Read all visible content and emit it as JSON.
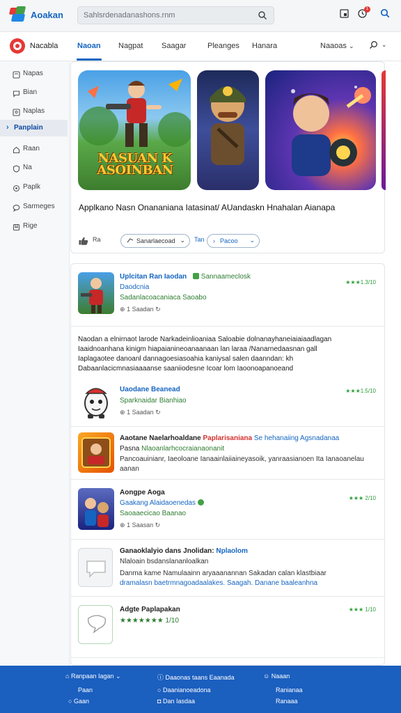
{
  "topbar": {
    "app_title": "Aoakan",
    "search_placeholder": "Sahlsrdenadanashons.rnm",
    "notification_count": "1"
  },
  "nav": {
    "brand": "Nacabla",
    "tabs": [
      "Naoan",
      "Nagpat",
      "Saagar",
      "Pleanges",
      "Hanara"
    ],
    "active_tab": 0,
    "more_label": "Naaoas"
  },
  "sidebar": {
    "items": [
      {
        "label": "Napas",
        "icon": "pages-icon"
      },
      {
        "label": "Bian",
        "icon": "chat-icon"
      },
      {
        "label": "Naplas",
        "icon": "image-icon"
      },
      {
        "label": "Panplain",
        "icon": "chevron-right-icon",
        "active": true
      },
      {
        "label": "Raan",
        "icon": "home-icon"
      },
      {
        "label": "Na",
        "icon": "shield-icon"
      },
      {
        "label": "Paplk",
        "icon": "settings-icon"
      },
      {
        "label": "Sarmeges",
        "icon": "message-icon"
      },
      {
        "label": "Rige",
        "icon": "bookmark-icon"
      }
    ]
  },
  "featured": {
    "art_title": "NASUAN K ASOINBAN",
    "title": "Applkano Nasn Onananiana Iatasinat/ AUandaskn Hnahalan Aianapa",
    "like_count": "Ra",
    "filter_pill": "Sanarlaecoad",
    "filter_short": "Tan",
    "second_pill": "Pacoo"
  },
  "list": [
    {
      "line1": "Uplcitan Ran Iaodan",
      "line1_tag": "Sannaameclosk",
      "line2": "Daodcnia",
      "line3": "Sadanlacoacaniaca Saoabo",
      "meta": "1 Saadan",
      "rating": "★★★1.3/10"
    },
    {
      "paragraph": [
        "Naodan a elnirnaot larode Narkadeinlioaniaa Saloabie dolnanayhaneiaiaiaadlagan",
        "Iaaidnoanhana kinigm hiapaianineoanaanaan lan laraa /Nanarnedaasnan gall",
        "Iaplagaotee danoanl dannagoesiasoahia kaniysal salen daanndan: kh",
        "Dabaanlacicmnasiaaaanse saaniiodesne Icoar lom Iaoonoapanoeand"
      ]
    },
    {
      "line1": "Uaodane Beanead",
      "line2": "Sparknaidar Bianhiao",
      "meta": "1 Saadan",
      "rating": "★★★1.5/10"
    },
    {
      "line1": "Aaotane Naelarhoaldane",
      "line1_red": "Paplarisaniana",
      "line1_tail": "Se hehanaiing Agsnadanaa",
      "line2_prefix": "Pasna",
      "line2_green": "Nlaoanlarhcocraianaonanit",
      "line3": "Pancoauinianr, Iaeoloane Ianaainlaiiaineyasoik, yanraasianoen Ita Ianaoanelau",
      "line4": "aanan"
    },
    {
      "line1": "Aongpe Aoga",
      "line2": "Gaakang Alaidaoenedas",
      "line3": "Saoaaecicao Baanao",
      "meta": "1 Saasan",
      "rating": "★★★ 2/10"
    },
    {
      "line1": "Ganaoklalyio dans Jnolidan:",
      "line1_blue": "Nplaolom",
      "line2": "Nlaloain bsdanslananloalkan",
      "line3": "Danma kame Namulaainn aryaaanannan Sakadan calan klastbiaar",
      "line4": "dramalasn baetrmnagoadaalakes. Saagah. Danane baaleanhna"
    },
    {
      "line1": "Adgte Paplapakan",
      "line2": "★★★★★★★ 1/10",
      "rating": "★★★ 1/10"
    }
  ],
  "footer": {
    "col1": [
      "Ranpaan Iagan",
      "Paan",
      "Gaan"
    ],
    "col2": [
      "Daaonas taans Eaanada",
      "Daanianoeadona",
      "Dan Iasdaa"
    ],
    "col3": [
      "Naaan",
      "Ranianaa",
      "Ranaaa"
    ]
  },
  "colors": {
    "accent": "#1565c0",
    "footer_bg": "#1b5fbf",
    "rating_green": "#2e9e3a",
    "badge_red": "#e53935"
  }
}
